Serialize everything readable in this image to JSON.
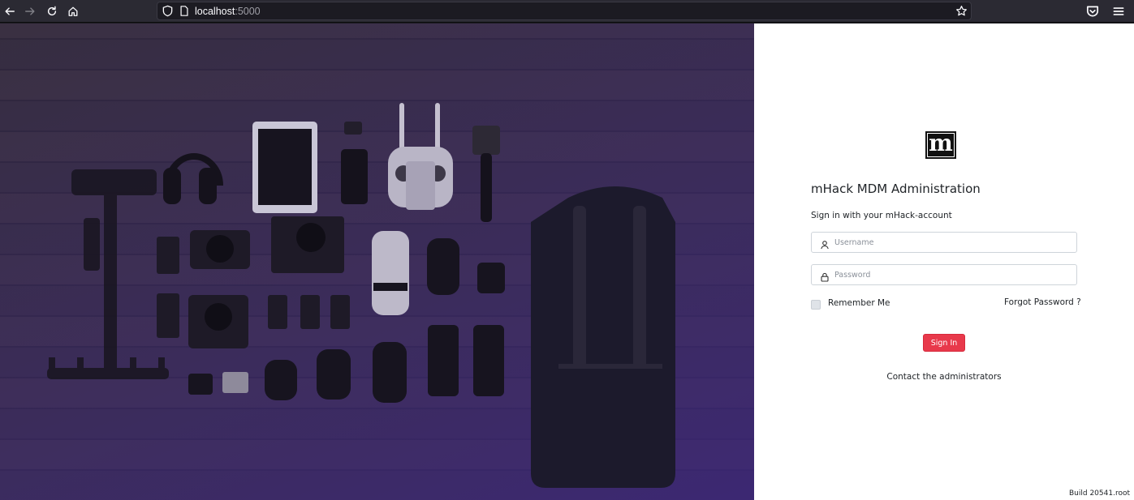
{
  "browser": {
    "url_host": "localhost",
    "url_port": ":5000",
    "icons": [
      "back-icon",
      "forward-icon",
      "reload-icon",
      "home-icon",
      "shield-icon",
      "page-icon",
      "bookmark-star-icon",
      "pocket-icon",
      "hamburger-menu-icon"
    ]
  },
  "hero": {
    "description_colors": {
      "overlay": "#3c2a7d",
      "wood": "#3d3437"
    }
  },
  "login": {
    "logo_letter": "m",
    "title": "mHack MDM Administration",
    "subtitle": "Sign in with your mHack-account",
    "username_placeholder": "Username",
    "username_value": "",
    "password_placeholder": "Password",
    "password_value": "",
    "remember_label": "Remember Me",
    "remember_checked": false,
    "forgot_label": "Forgot Password ?",
    "signin_label": "Sign In",
    "contact_label": "Contact the administrators",
    "accent_color": "#e8394b"
  },
  "footer": {
    "build": "Build 20541.root"
  }
}
